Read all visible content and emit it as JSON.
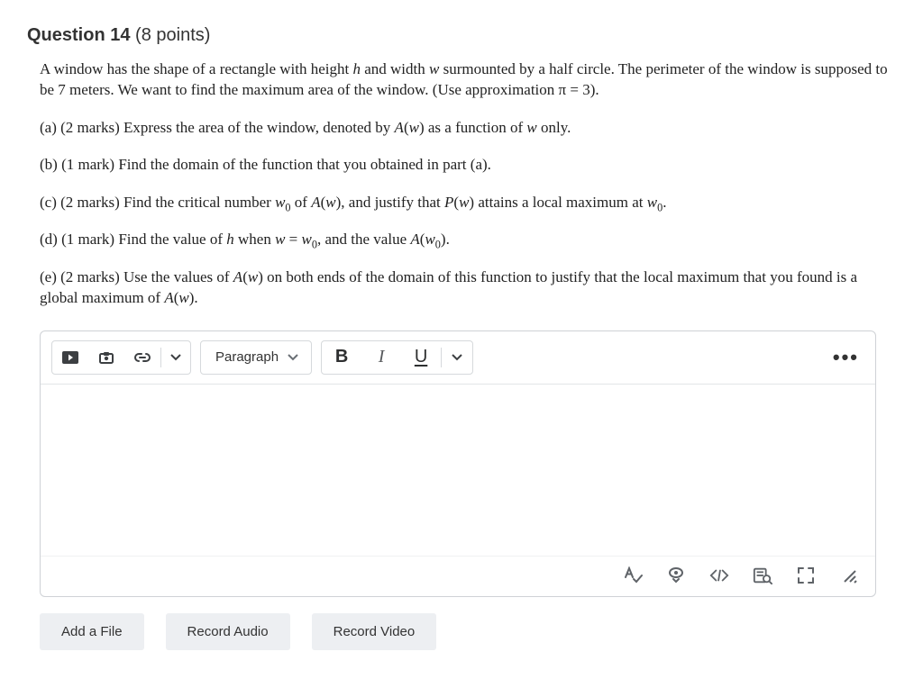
{
  "question": {
    "number_label": "Question 14",
    "points_label": "(8 points)",
    "intro": "A window has the shape of a rectangle with height <span class='it'>h</span> and width <span class='it'>w</span> surmounted by a half circle.  The perimeter of the window is supposed to be 7 meters.  We want to find the maximum area of the window.  (Use approximation &pi;&nbsp;=&nbsp;3).",
    "parts": {
      "a": "(a)  (2 marks)  Express the area of the window, denoted by <span class='it'>A</span>(<span class='it'>w</span>) as a function of <span class='it'>w</span> only.",
      "b": "(b)  (1 mark)  Find the domain of the function that you obtained in part (a).",
      "c": "(c)  (2 marks)  Find the critical number <span class='it'>w</span><span class='sub'>0</span> of <span class='it'>A</span>(<span class='it'>w</span>), and justify that <span class='it'>P</span>(<span class='it'>w</span>) attains a local maximum at <span class='it'>w</span><span class='sub'>0</span>.",
      "d": "(d)  (1 mark)  Find the value of <span class='it'>h</span> when <span class='it'>w</span> = <span class='it'>w</span><span class='sub'>0</span>, and the value <span class='it'>A</span>(<span class='it'>w</span><span class='sub'>0</span>).",
      "e": "(e)  (2 marks)  Use the values of <span class='it'>A</span>(<span class='it'>w</span>) on both ends of the domain of this function to justify that the local maximum that you found is a global maximum of <span class='it'>A</span>(<span class='it'>w</span>)."
    }
  },
  "toolbar": {
    "paragraph_label": "Paragraph",
    "bold_letter": "B",
    "italic_letter": "I",
    "underline_letter": "U"
  },
  "actions": {
    "add_file": "Add a File",
    "record_audio": "Record Audio",
    "record_video": "Record Video"
  }
}
